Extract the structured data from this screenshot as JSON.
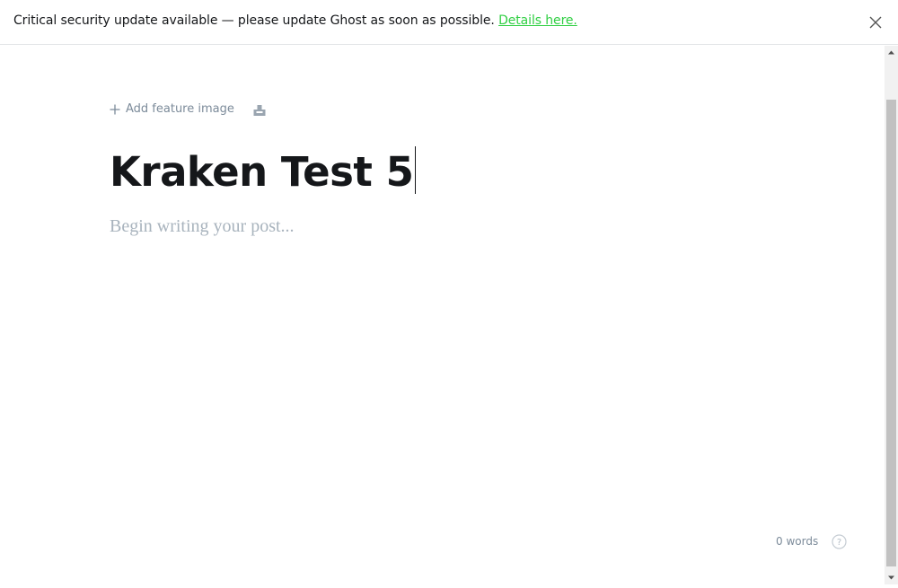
{
  "banner": {
    "message": "Critical security update available — please update Ghost as soon as possible.",
    "link_text": "Details here.",
    "close_icon": "close-icon",
    "link_color": "#30cf43"
  },
  "editor": {
    "feature_image_label": "Add feature image",
    "feature_image_icon": "plus-icon",
    "snippet_icon": "card-icon",
    "title": "Kraken Test 5",
    "body_placeholder": "Begin writing your post...",
    "word_count": "0 words",
    "help_icon": "question-circle-icon"
  },
  "colors": {
    "text": "#15171a",
    "muted": "#7c8b9a",
    "placeholder": "#a8b3bd"
  }
}
